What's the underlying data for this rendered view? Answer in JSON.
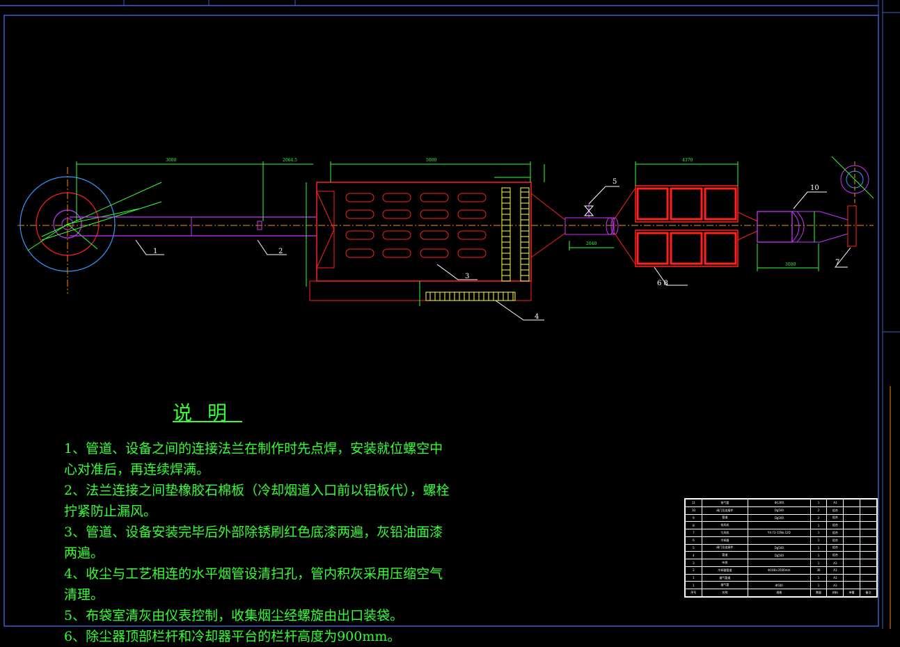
{
  "colors": {
    "background": "#000000",
    "frame": "#3a5fcd",
    "centerline": "#ff8c00",
    "pipe": "#cc33ff",
    "dust_body": "#ff2020",
    "dimension": "#33ff33",
    "bags": "#ffff33",
    "leader": "#ffffff",
    "fan_circle": "#3399ff",
    "notes_text": "#33ff33"
  },
  "labels": {
    "item_1": "1",
    "item_2": "2",
    "item_3": "3",
    "item_4": "4",
    "item_5": "5",
    "item_6_8": "6 8",
    "item_7": "7",
    "item_10": "10"
  },
  "notes": {
    "title": "说明",
    "items": [
      "1、管道、设备之间的连接法兰在制作时先点焊，安装就位螺空中心对准后，再连续焊满。",
      "2、法兰连接之间垫橡胶石棉板（冷却烟道入口前以铝板代），螺栓拧紧防止漏风。",
      "3、管道、设备安装完毕后外部除锈刷红色底漆两遍，灰铅油面漆两遍。",
      "4、收尘与工艺相连的水平烟管设清扫孔，管内积灰采用压缩空气清理。",
      "5、布袋室清灰由仪表控制，收集烟尘经螺旋由出口装袋。",
      "6、除尘器顶部栏杆和冷却器平台的栏杆高度为900mm。"
    ]
  },
  "bom_rows": [
    [
      "11",
      "排气管",
      "Φ1300",
      "1",
      "A3",
      "",
      ""
    ],
    [
      "10",
      "阀门及连接件",
      "Dg500",
      "2",
      "组合",
      "",
      ""
    ],
    [
      "9",
      "管道",
      "Dg500",
      "2",
      "组合",
      "",
      ""
    ],
    [
      "8",
      "排风机",
      "",
      "1",
      "组合",
      "",
      ""
    ],
    [
      "7",
      "引风机",
      "Y4-73-11No.12D",
      "1",
      "组合",
      "",
      ""
    ],
    [
      "6",
      "冷却器",
      "",
      "1",
      "组合",
      "",
      ""
    ],
    [
      "5",
      "阀门及连接件",
      "Dg500",
      "1",
      "组合",
      "",
      ""
    ],
    [
      "4",
      "管道",
      "Dg500",
      "1",
      "组合",
      "",
      ""
    ],
    [
      "3",
      "布袋",
      "",
      "1",
      "A3",
      "",
      ""
    ],
    [
      "2",
      "冷却器管道",
      "Φ108×3500mm",
      "36",
      "A3",
      "",
      ""
    ],
    [
      "1",
      "烟气管道",
      "",
      "1",
      "A3",
      "",
      ""
    ],
    [
      "1",
      "烟气管",
      "Φ500",
      "1",
      "A3",
      "",
      ""
    ],
    [
      "序号",
      "名称",
      "规格",
      "数量",
      "材料",
      "单重",
      "备注"
    ]
  ]
}
